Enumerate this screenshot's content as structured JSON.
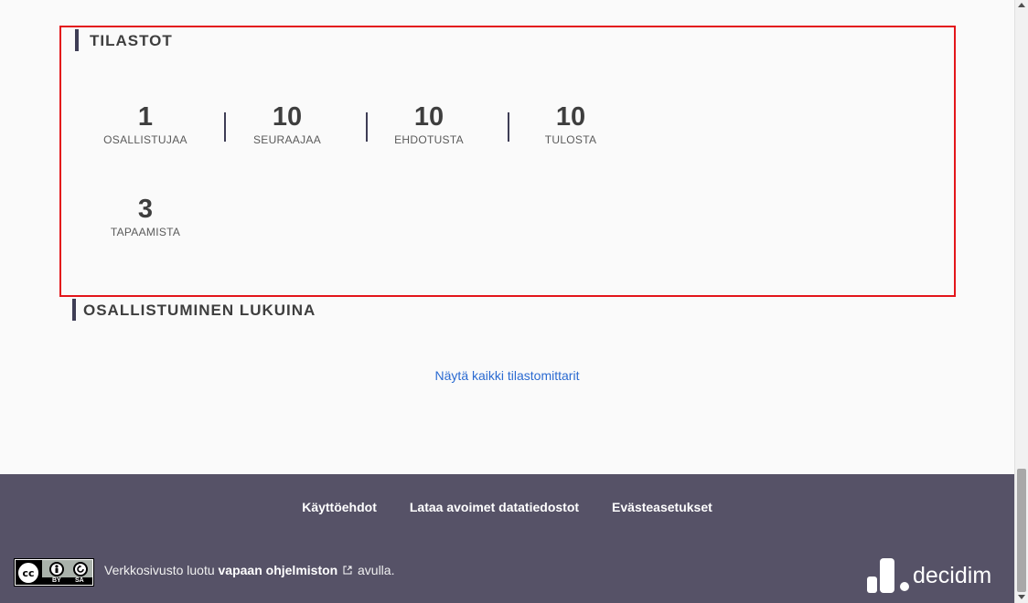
{
  "statistics": {
    "title": "TILASTOT",
    "items": [
      {
        "value": "1",
        "label": "OSALLISTUJAA"
      },
      {
        "value": "10",
        "label": "SEURAAJAA"
      },
      {
        "value": "10",
        "label": "EHDOTUSTA"
      },
      {
        "value": "10",
        "label": "TULOSTA"
      },
      {
        "value": "3",
        "label": "TAPAAMISTA"
      }
    ]
  },
  "participation": {
    "title": "OSALLISTUMINEN LUKUINA",
    "show_all_link": "Näytä kaikki tilastomittarit"
  },
  "footer": {
    "links": [
      "Käyttöehdot",
      "Lataa avoimet datatiedostot",
      "Evästeasetukset"
    ],
    "made_with_prefix": "Verkkosivusto luotu",
    "made_with_link": "vapaan ohjelmiston",
    "made_with_suffix": "avulla.",
    "license_badge_text": [
      "BY",
      "SA"
    ],
    "logo_text": "decidim"
  },
  "colors": {
    "accent_bar": "#3e3d55",
    "link": "#2a6ad1",
    "footer_bg": "#565267",
    "highlight_border": "#e3151a"
  }
}
